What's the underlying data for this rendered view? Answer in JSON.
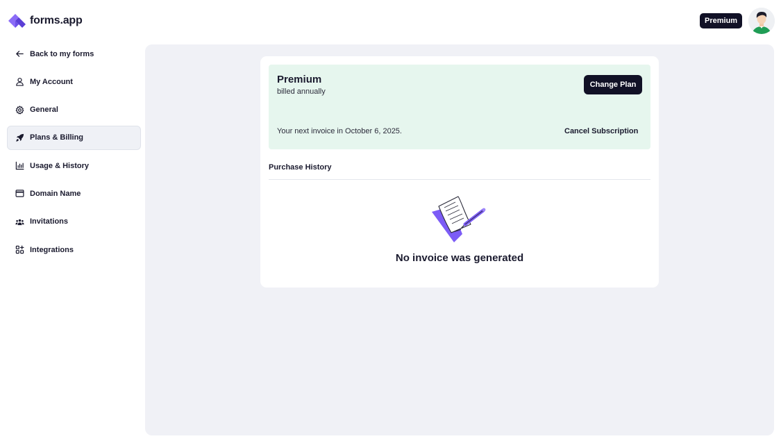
{
  "header": {
    "logo_text": "forms.app",
    "premium_badge": "Premium"
  },
  "sidebar": {
    "items": [
      {
        "label": "Back to my forms",
        "icon": "arrow-left-icon"
      },
      {
        "label": "My Account",
        "icon": "user-icon"
      },
      {
        "label": "General",
        "icon": "gear-icon"
      },
      {
        "label": "Plans & Billing",
        "icon": "rocket-icon",
        "active": true
      },
      {
        "label": "Usage & History",
        "icon": "bar-chart-icon"
      },
      {
        "label": "Domain Name",
        "icon": "browser-window-icon"
      },
      {
        "label": "Invitations",
        "icon": "users-icon"
      },
      {
        "label": "Integrations",
        "icon": "grid-plus-icon"
      }
    ]
  },
  "plan": {
    "name": "Premium",
    "period": "billed annually",
    "change_label": "Change Plan",
    "next_invoice": "Your next invoice in October 6, 2025.",
    "cancel_label": "Cancel Subscription"
  },
  "history": {
    "title": "Purchase History",
    "empty_text": "No invoice was generated"
  },
  "colors": {
    "brand_purple": "#7c5cf6",
    "dark": "#111126",
    "plan_bg": "#e6f6ee",
    "main_bg": "#f0f1f6"
  }
}
